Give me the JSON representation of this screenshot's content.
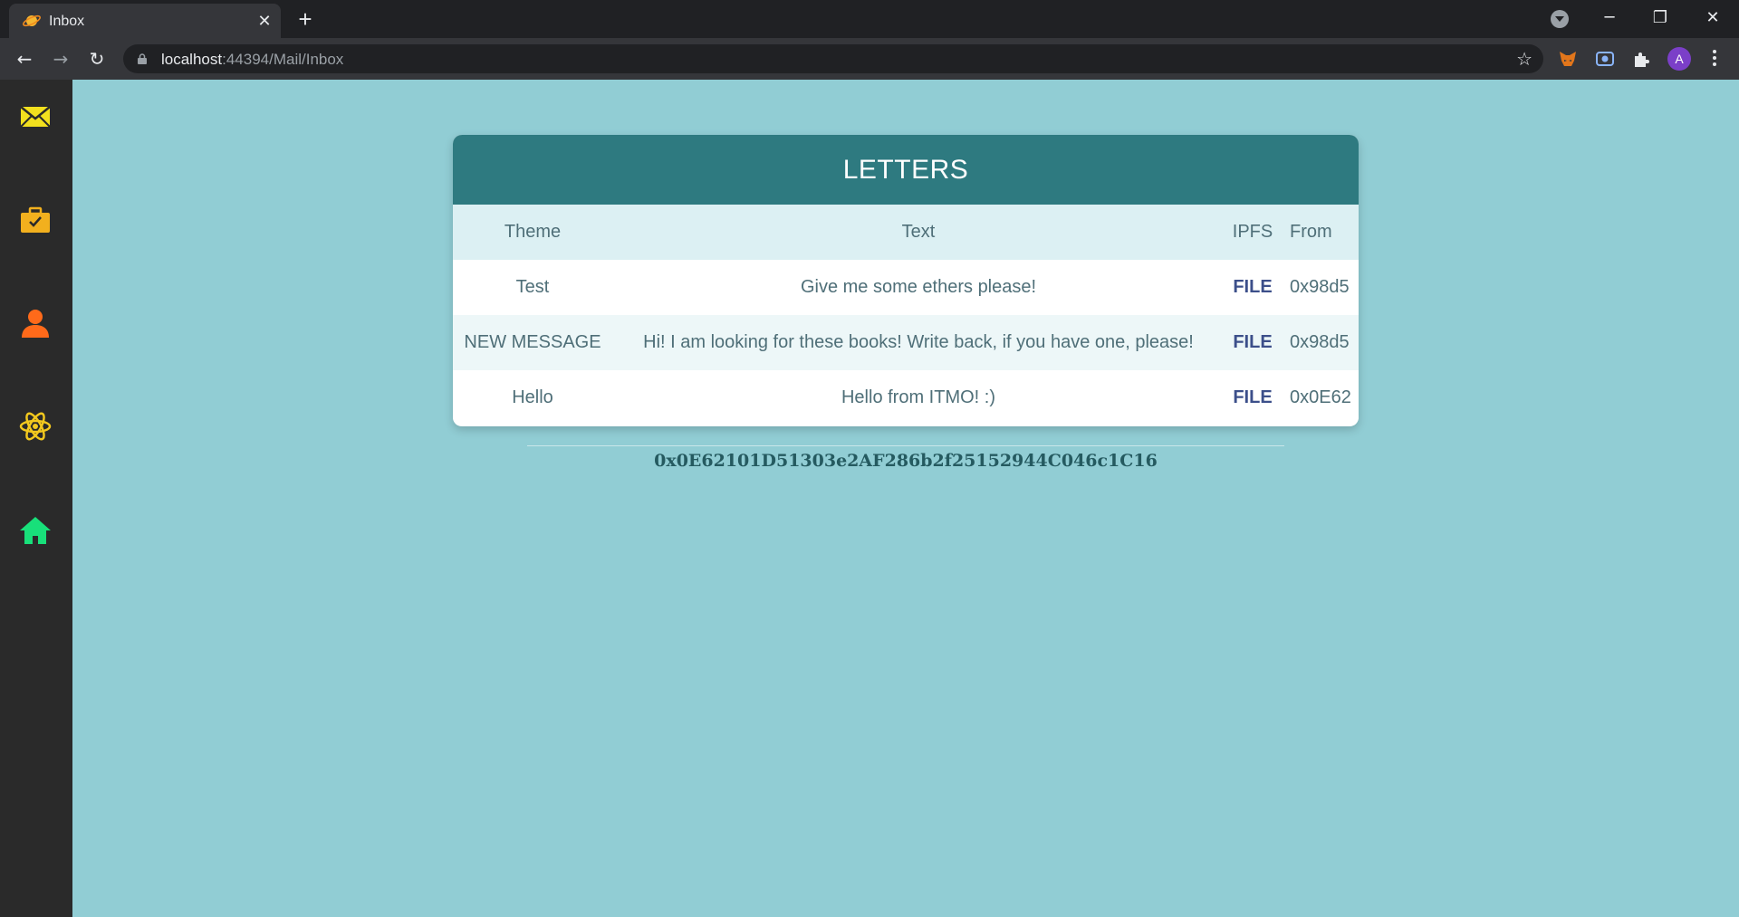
{
  "browser": {
    "tab_title": "Inbox",
    "tab_close": "✕",
    "new_tab": "+",
    "url_host": "localhost",
    "url_path": ":44394/Mail/Inbox",
    "profile_initial": "A",
    "window_controls": {
      "minimize": "─",
      "restore": "❐",
      "close": "✕"
    },
    "nav": {
      "back": "←",
      "forward": "→",
      "reload": "↻"
    },
    "star": "☆"
  },
  "sidebar": {
    "items": [
      {
        "icon": "mail-icon",
        "color": "#f2e01e"
      },
      {
        "icon": "briefcase-icon",
        "color": "#f2b01e"
      },
      {
        "icon": "user-icon",
        "color": "#ff6a1a"
      },
      {
        "icon": "atom-icon",
        "color": "#f2c81e"
      },
      {
        "icon": "home-icon",
        "color": "#18e07a"
      }
    ]
  },
  "letters": {
    "title": "LETTERS",
    "columns": [
      "Theme",
      "Text",
      "IPFS",
      "From"
    ],
    "rows": [
      {
        "theme": "Test",
        "text": "Give me some ethers please!",
        "ipfs": "FILE",
        "from": "0x98d5"
      },
      {
        "theme": "NEW MESSAGE",
        "text": "Hi! I am looking for these books! Write back, if you have one, please!",
        "ipfs": "FILE",
        "from": "0x98d5"
      },
      {
        "theme": "Hello",
        "text": "Hello from ITMO! :)",
        "ipfs": "FILE",
        "from": "0x0E62"
      }
    ]
  },
  "account_address": "0x0E62101D51303e2AF286b2f25152944C046c1C16",
  "colors": {
    "page_bg": "#91cdd4",
    "header_bg": "#2e7a80",
    "sidebar_bg": "#2a2a2a",
    "file_link": "#3c4f8a"
  }
}
